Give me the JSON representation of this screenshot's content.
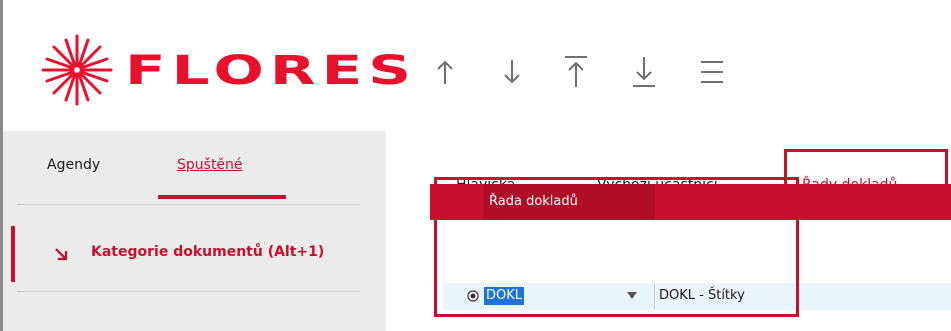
{
  "header": {
    "logo_text": "FLORES",
    "toolbar": {
      "up": "arrow-up-icon",
      "down": "arrow-down-icon",
      "first": "arrow-top-icon",
      "last": "arrow-bottom-icon",
      "menu": "menu-icon"
    }
  },
  "sidebar": {
    "tabs": [
      {
        "label": "Agendy"
      },
      {
        "label": "Spuštěné",
        "active": true
      }
    ],
    "items": [
      {
        "label": "Kategorie dokumentů (Alt+1)"
      }
    ]
  },
  "main": {
    "tabs": [
      {
        "label_prefix": "",
        "label_underline": "H",
        "label_rest": "lavička"
      },
      {
        "label_prefix": "Výchozí ú",
        "label_underline": "č",
        "label_rest": "astníci"
      },
      {
        "label_prefix": "Řady ",
        "label_underline": "d",
        "label_rest": "okladů",
        "active": true
      }
    ],
    "grid": {
      "columns": [
        {
          "label": "Řada dokladů"
        }
      ],
      "rows": [
        {
          "code": "DOKL",
          "description": "DOKL - Štítky"
        }
      ]
    }
  },
  "colors": {
    "accent": "#c8102e",
    "sidebar_bg": "#ebebeb",
    "row_bg": "#e9f5fd"
  }
}
